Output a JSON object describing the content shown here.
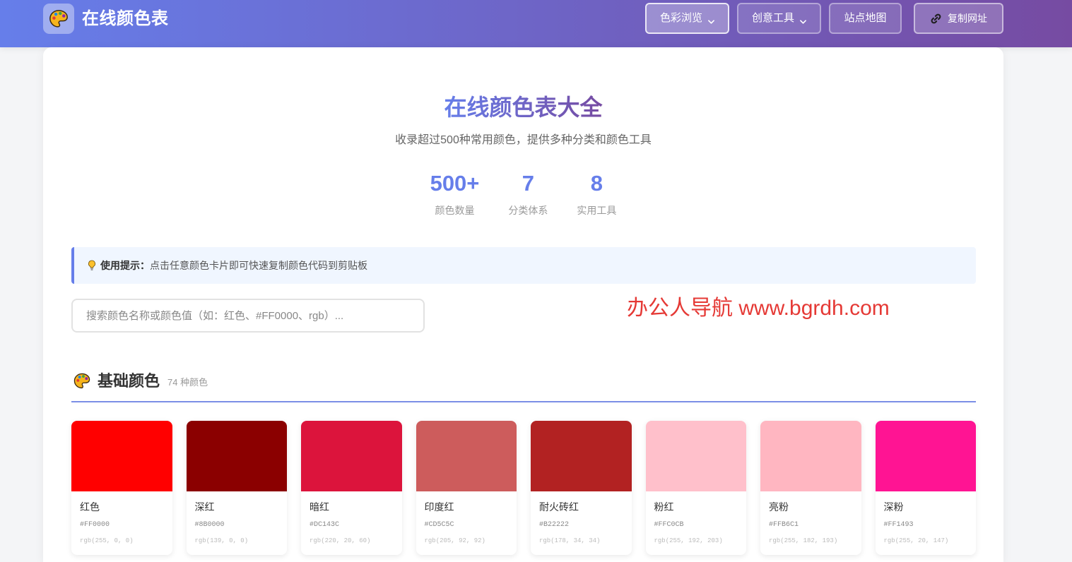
{
  "theme": {
    "header_gradient_start": "#667eea",
    "header_gradient_end": "#764ba2",
    "accent": "#667eea",
    "watermark_color": "#e53935"
  },
  "header": {
    "logo_icon": "palette-icon",
    "title": "在线颜色表",
    "nav": [
      {
        "label": "色彩浏览",
        "dropdown": true,
        "active": true
      },
      {
        "label": "创意工具",
        "dropdown": true,
        "active": false
      },
      {
        "label": "站点地图",
        "dropdown": false,
        "active": false
      },
      {
        "label": "复制网址",
        "icon": "link-icon",
        "active": false
      }
    ]
  },
  "hero": {
    "title": "在线颜色表大全",
    "subtitle": "收录超过500种常用颜色，提供多种分类和颜色工具",
    "stats": [
      {
        "value": "500+",
        "label": "颜色数量"
      },
      {
        "value": "7",
        "label": "分类体系"
      },
      {
        "value": "8",
        "label": "实用工具"
      }
    ]
  },
  "tip": {
    "icon": "lightbulb-icon",
    "label": "使用提示：",
    "text": "点击任意颜色卡片即可快速复制颜色代码到剪贴板"
  },
  "search": {
    "placeholder": "搜索颜色名称或颜色值（如：红色、#FF0000、rgb）..."
  },
  "watermark": {
    "text": "办公人导航 www.bgrdh.com"
  },
  "section": {
    "icon": "palette-icon",
    "title": "基础颜色",
    "count": "74 种颜色",
    "colors": [
      {
        "name": "红色",
        "hex": "#FF0000",
        "rgb": "rgb(255, 0, 0)"
      },
      {
        "name": "深红",
        "hex": "#8B0000",
        "rgb": "rgb(139, 0, 0)"
      },
      {
        "name": "暗红",
        "hex": "#DC143C",
        "rgb": "rgb(220, 20, 60)"
      },
      {
        "name": "印度红",
        "hex": "#CD5C5C",
        "rgb": "rgb(205, 92, 92)"
      },
      {
        "name": "耐火砖红",
        "hex": "#B22222",
        "rgb": "rgb(178, 34, 34)"
      },
      {
        "name": "粉红",
        "hex": "#FFC0CB",
        "rgb": "rgb(255, 192, 203)"
      },
      {
        "name": "亮粉",
        "hex": "#FFB6C1",
        "rgb": "rgb(255, 182, 193)"
      },
      {
        "name": "深粉",
        "hex": "#FF1493",
        "rgb": "rgb(255, 20, 147)"
      }
    ]
  }
}
